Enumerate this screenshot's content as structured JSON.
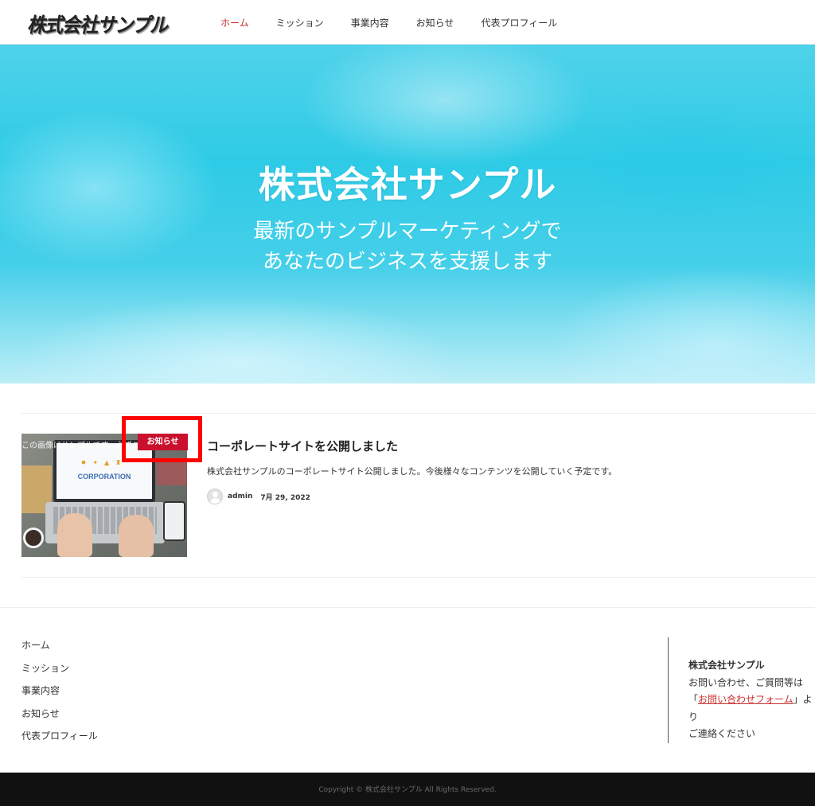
{
  "header": {
    "logo_text": "株式会社サンプル",
    "nav": [
      {
        "label": "ホーム",
        "active": true
      },
      {
        "label": "ミッション",
        "active": false
      },
      {
        "label": "事業内容",
        "active": false
      },
      {
        "label": "お知らせ",
        "active": false
      },
      {
        "label": "代表プロフィール",
        "active": false
      }
    ]
  },
  "hero": {
    "title": "株式会社サンプル",
    "subtitle_line1": "最新のサンプルマーケティングで",
    "subtitle_line2": "あなたのビジネスを支援します"
  },
  "post": {
    "category": "お知らせ",
    "thumbnail_caption": "この画像はサンプルです。必ずご自身の画像をお使いください",
    "thumbnail_screen_text": "CORPORATION",
    "title": "コーポレートサイトを公開しました",
    "excerpt": "株式会社サンプルのコーポレートサイト公開しました。今後様々なコンテンツを公開していく予定です。",
    "author": "admin",
    "date": "7月 29, 2022"
  },
  "footer": {
    "nav": [
      "ホーム",
      "ミッション",
      "事業内容",
      "お知らせ",
      "代表プロフィール"
    ],
    "company": "株式会社サンプル",
    "info_line1": "お問い合わせ、ご質問等は",
    "info_open_quote": "「",
    "contact_link": "お問い合わせフォーム",
    "info_close": "」より",
    "info_line3": "ご連絡ください",
    "copyright": "Copyright © 株式会社サンプル All Rights Reserved."
  },
  "colors": {
    "accent": "#c9302c",
    "badge": "#c9112d",
    "highlight_box": "#ff0000",
    "footer_bar": "#111111"
  }
}
